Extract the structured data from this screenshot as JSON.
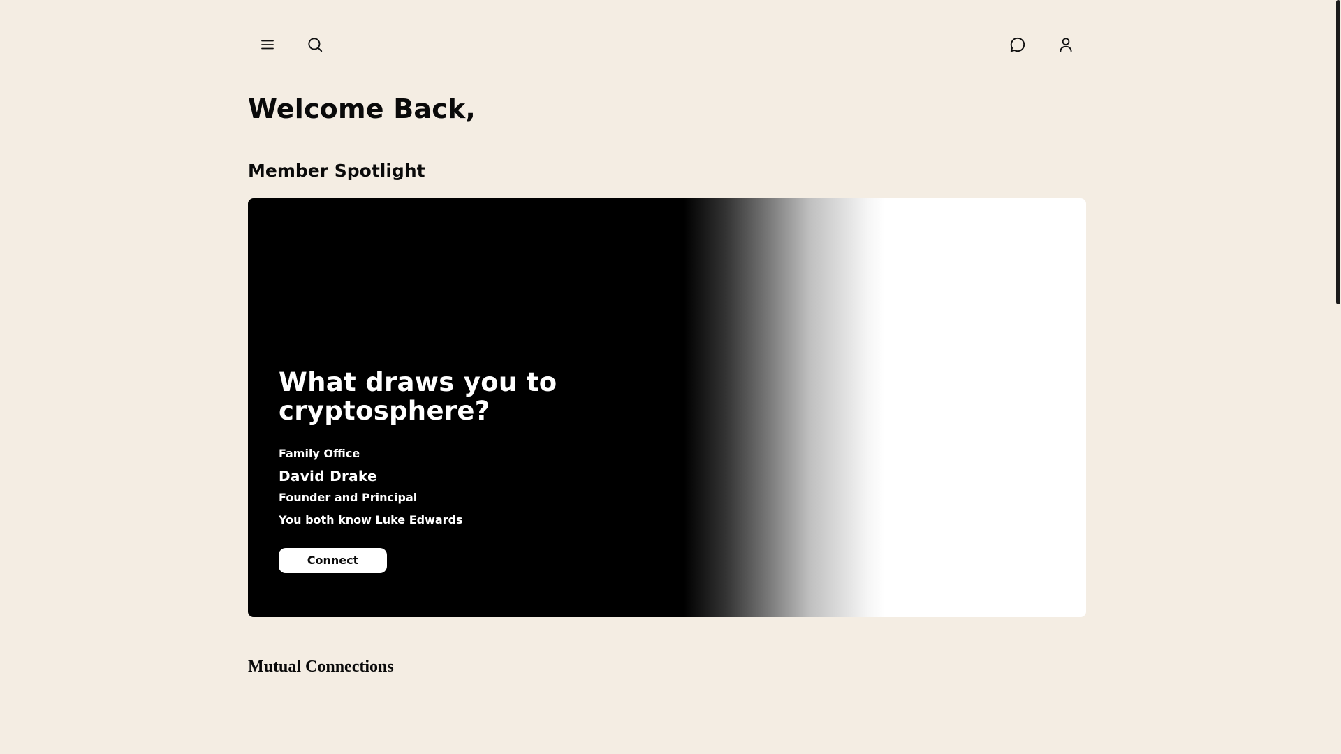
{
  "header": {
    "icons": {
      "menu": "menu-icon",
      "search": "search-icon",
      "messages": "chat-icon",
      "profile": "user-icon"
    }
  },
  "welcome": {
    "title": "Welcome Back,"
  },
  "spotlight": {
    "section_title": "Member Spotlight",
    "heading": "What draws you to cryptosphere?",
    "company": "Family Office",
    "name": "David Drake",
    "role": "Founder and Principal",
    "mutual": "You both know Luke Edwards",
    "connect_label": "Connect"
  },
  "mutual_connections": {
    "title": "Mutual Connections"
  },
  "colors": {
    "background": "#f4ede3",
    "card_dark": "#000000",
    "card_light": "#ffffff",
    "text": "#0a0a0a"
  }
}
